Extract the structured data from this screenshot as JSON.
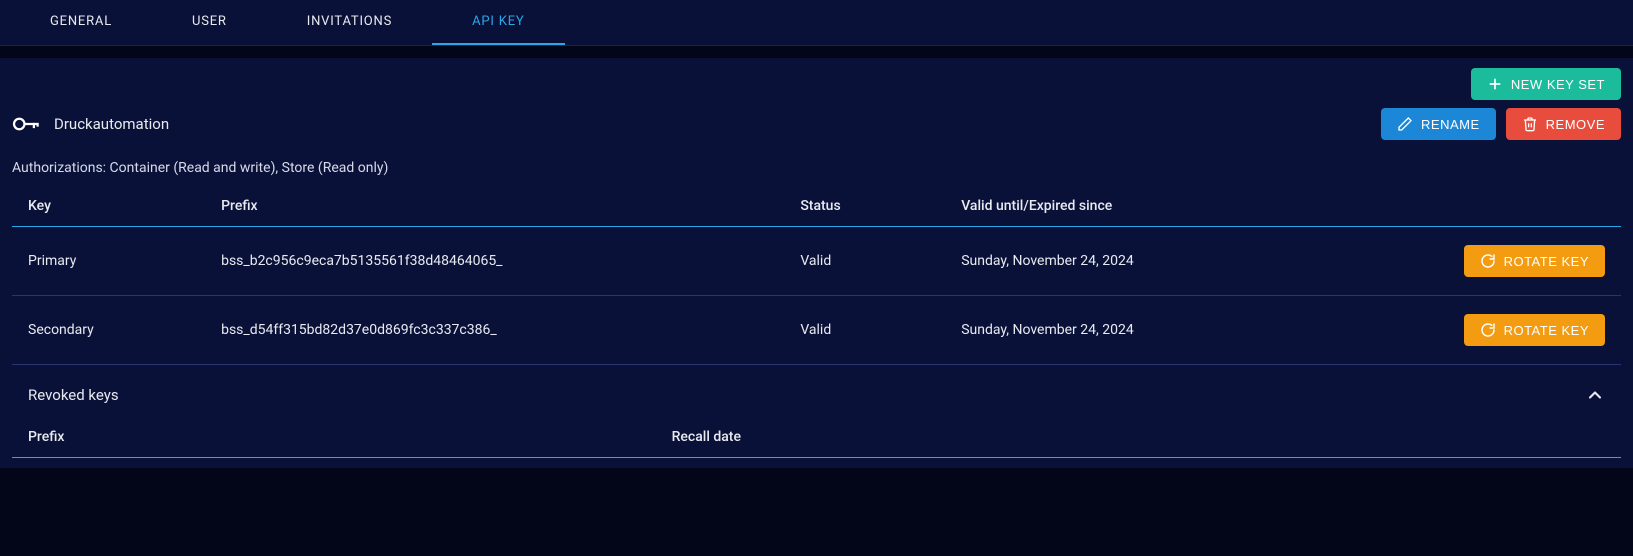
{
  "tabs": {
    "general": "GENERAL",
    "user": "USER",
    "invitations": "INVITATIONS",
    "api_key": "API KEY"
  },
  "toolbar": {
    "new_key_set": "NEW KEY SET"
  },
  "keyset": {
    "title": "Druckautomation",
    "rename": "RENAME",
    "remove": "REMOVE"
  },
  "authorizations": "Authorizations: Container (Read and write), Store (Read only)",
  "table": {
    "headers": {
      "key": "Key",
      "prefix": "Prefix",
      "status": "Status",
      "valid": "Valid until/Expired since"
    },
    "rows": [
      {
        "key": "Primary",
        "prefix": "bss_b2c956c9eca7b5135561f38d48464065_",
        "status": "Valid",
        "valid": "Sunday, November 24, 2024"
      },
      {
        "key": "Secondary",
        "prefix": "bss_d54ff315bd82d37e0d869fc3c337c386_",
        "status": "Valid",
        "valid": "Sunday, November 24, 2024"
      }
    ],
    "rotate_label": "ROTATE KEY"
  },
  "revoked": {
    "title": "Revoked keys",
    "headers": {
      "prefix": "Prefix",
      "recall_date": "Recall date"
    }
  }
}
